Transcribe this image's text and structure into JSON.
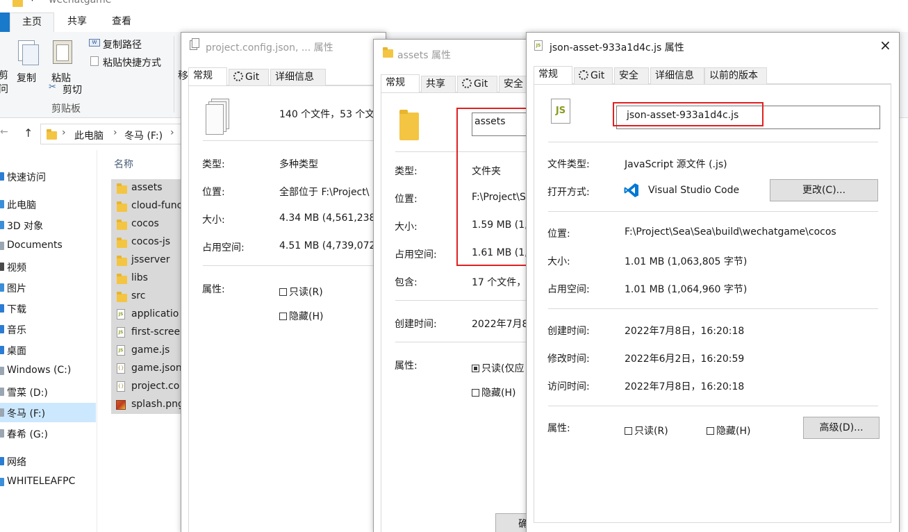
{
  "explorer": {
    "title": "wechatgame",
    "ribbon_tabs": [
      "主页",
      "共享",
      "查看"
    ],
    "ribbon": {
      "copy_path": "复制路径",
      "paste_shortcut": "粘贴快捷方式",
      "left_cut1": "剪",
      "left_cut2": "问",
      "copy": "复制",
      "paste": "粘贴",
      "cut": "剪切",
      "group": "剪贴板",
      "side_char": "移"
    },
    "breadcrumb": [
      "此电脑",
      "冬马 (F:)"
    ],
    "column_name": "名称",
    "nav": [
      {
        "label": "快速访问",
        "icon": "star-icon",
        "color": "#2b7cd3"
      },
      {
        "label": "此电脑",
        "icon": "computer-icon",
        "color": "#3b8ed8"
      },
      {
        "label": "3D 对象",
        "icon": "cube-icon",
        "color": "#3b8ed8"
      },
      {
        "label": "Documents",
        "icon": "document-icon",
        "color": "#9aa6b2"
      },
      {
        "label": "视频",
        "icon": "video-icon",
        "color": "#4a4a4a"
      },
      {
        "label": "图片",
        "icon": "picture-icon",
        "color": "#3b8ed8"
      },
      {
        "label": "下载",
        "icon": "download-icon",
        "color": "#2b7cd3"
      },
      {
        "label": "音乐",
        "icon": "music-icon",
        "color": "#2b7cd3"
      },
      {
        "label": "桌面",
        "icon": "desktop-icon",
        "color": "#2b7cd3"
      },
      {
        "label": "Windows (C:)",
        "icon": "drive-icon",
        "color": "#9aa6b2"
      },
      {
        "label": "雪菜 (D:)",
        "icon": "drive-icon",
        "color": "#9aa6b2"
      },
      {
        "label": "冬马 (F:)",
        "icon": "drive-icon",
        "color": "#9aa6b2"
      },
      {
        "label": "春希 (G:)",
        "icon": "drive-icon",
        "color": "#9aa6b2"
      },
      {
        "label": "网络",
        "icon": "network-icon",
        "color": "#2b7cd3"
      },
      {
        "label": "WHITELEAFPC",
        "icon": "pc-icon",
        "color": "#3b8ed8"
      }
    ],
    "files": [
      {
        "name": "assets",
        "type": "folder"
      },
      {
        "name": "cloud-func",
        "type": "folder"
      },
      {
        "name": "cocos",
        "type": "folder"
      },
      {
        "name": "cocos-js",
        "type": "folder"
      },
      {
        "name": "jsserver",
        "type": "folder"
      },
      {
        "name": "libs",
        "type": "folder"
      },
      {
        "name": "src",
        "type": "folder"
      },
      {
        "name": "applicatio",
        "type": "js"
      },
      {
        "name": "first-scree",
        "type": "js"
      },
      {
        "name": "game.js",
        "type": "js"
      },
      {
        "name": "game.json",
        "type": "json"
      },
      {
        "name": "project.co",
        "type": "json"
      },
      {
        "name": "splash.png",
        "type": "png"
      }
    ]
  },
  "dialog1": {
    "title": "project.config.json, ... 属性",
    "tabs": [
      "常规",
      "Git",
      "详细信息"
    ],
    "tab_side": "移",
    "summary": "140 个文件，53 个文",
    "rows": [
      {
        "label": "类型:",
        "value": "多种类型"
      },
      {
        "label": "位置:",
        "value": "全部位于 F:\\Project\\"
      },
      {
        "label": "大小:",
        "value": "4.34 MB (4,561,238"
      },
      {
        "label": "占用空间:",
        "value": "4.51 MB (4,739,072"
      }
    ],
    "attr_label": "属性:",
    "readonly": "只读(R)",
    "hidden": "隐藏(H)"
  },
  "dialog2": {
    "title": "assets 属性",
    "tabs": [
      "常规",
      "共享",
      "Git",
      "安全"
    ],
    "name_value": "assets",
    "rows": [
      {
        "label": "类型:",
        "value": "文件夹"
      },
      {
        "label": "位置:",
        "value": "F:\\Project\\S"
      },
      {
        "label": "大小:",
        "value": "1.59 MB (1,"
      },
      {
        "label": "占用空间:",
        "value": "1.61 MB (1,"
      },
      {
        "label": "包含:",
        "value": "17 个文件，"
      }
    ],
    "created_label": "创建时间:",
    "created_value": "2022年7月8",
    "attr_label": "属性:",
    "readonly": "只读(仅应",
    "hidden": "隐藏(H)",
    "bottom_button": "确"
  },
  "dialog3": {
    "title": "json-asset-933a1d4c.js 属性",
    "close": "×",
    "tabs": [
      "常规",
      "Git",
      "安全",
      "详细信息",
      "以前的版本"
    ],
    "file_icon_text": "JS",
    "name_value": "json-asset-933a1d4c.js",
    "type_label": "文件类型:",
    "type_value": "JavaScript 源文件 (.js)",
    "open_label": "打开方式:",
    "open_value": "Visual Studio Code",
    "change_button": "更改(C)...",
    "rows": [
      {
        "label": "位置:",
        "value": "F:\\Project\\Sea\\Sea\\build\\wechatgame\\cocos"
      },
      {
        "label": "大小:",
        "value": "1.01 MB (1,063,805 字节)"
      },
      {
        "label": "占用空间:",
        "value": "1.01 MB (1,064,960 字节)"
      }
    ],
    "times": [
      {
        "label": "创建时间:",
        "value": "2022年7月8日，16:20:18"
      },
      {
        "label": "修改时间:",
        "value": "2022年6月2日，16:20:59"
      },
      {
        "label": "访问时间:",
        "value": "2022年7月8日，16:20:18"
      }
    ],
    "attr_label": "属性:",
    "readonly": "只读(R)",
    "hidden": "隐藏(H)",
    "advanced_button": "高级(D)..."
  },
  "colors": {
    "highlight_red": "#e02020",
    "selection_blue": "#cce8ff",
    "ribbon_active": "#ffffff",
    "vscode_blue": "#0078d4"
  }
}
